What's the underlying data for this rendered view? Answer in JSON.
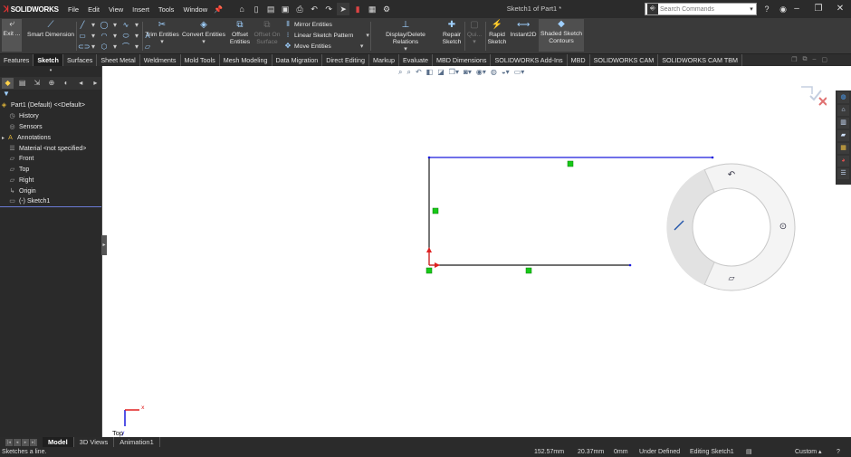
{
  "app": {
    "name": "SOLIDWORKS",
    "document_title": "Sketch1 of Part1 *"
  },
  "menu": [
    "File",
    "Edit",
    "View",
    "Insert",
    "Tools",
    "Window"
  ],
  "search": {
    "placeholder": "Search Commands"
  },
  "ribbon": {
    "exit_sketch": "Exit ...",
    "smart_dimension": "Smart Dimension",
    "trim_entities": "Trim Entities",
    "convert_entities": "Convert Entities",
    "offset_entities": [
      "Offset",
      "Entities"
    ],
    "offset_on_surface": [
      "Offset On",
      "Surface"
    ],
    "mirror_entities": "Mirror Entities",
    "linear_sketch_pattern": "Linear Sketch Pattern",
    "move_entities": "Move Entities",
    "display_delete_relations": "Display/Delete Relations",
    "repair_sketch": [
      "Repair",
      "Sketch"
    ],
    "quick_snaps": "Qui...",
    "rapid_sketch": [
      "Rapid",
      "Sketch"
    ],
    "instant2d": "Instant2D",
    "shaded_sketch_contours": [
      "Shaded Sketch",
      "Contours"
    ]
  },
  "tabs": [
    "Features",
    "Sketch",
    "Surfaces",
    "Sheet Metal",
    "Weldments",
    "Mold Tools",
    "Mesh Modeling",
    "Data Migration",
    "Direct Editing",
    "Markup",
    "Evaluate",
    "MBD Dimensions",
    "SOLIDWORKS Add-Ins",
    "MBD",
    "SOLIDWORKS CAM",
    "SOLIDWORKS CAM TBM"
  ],
  "active_tab": "Sketch",
  "feature_tree": {
    "root": "Part1 (Default) <<Default>",
    "items": [
      "History",
      "Sensors",
      "Annotations",
      "Material <not specified>",
      "Front",
      "Top",
      "Right",
      "Origin",
      "(-) Sketch1"
    ]
  },
  "graphics": {
    "view_label": "Top",
    "triad": {
      "x": "x",
      "y": "y"
    }
  },
  "bottom_tabs": [
    "Model",
    "3D Views",
    "Animation1"
  ],
  "active_bottom_tab": "Model",
  "status": {
    "message": "Sketches a line.",
    "x": "152.57mm",
    "y": "20.37mm",
    "z": "0mm",
    "state": "Under Defined",
    "editing": "Editing Sketch1",
    "units": "Custom"
  },
  "colors": {
    "sketch_line_blue": "#1a1adc",
    "sketch_line_black": "#1a1a1a",
    "relation_green": "#17c917",
    "origin_red": "#e02020",
    "pie_bg": "#f4f4f4",
    "pie_highlight": "#e2e2e2"
  }
}
